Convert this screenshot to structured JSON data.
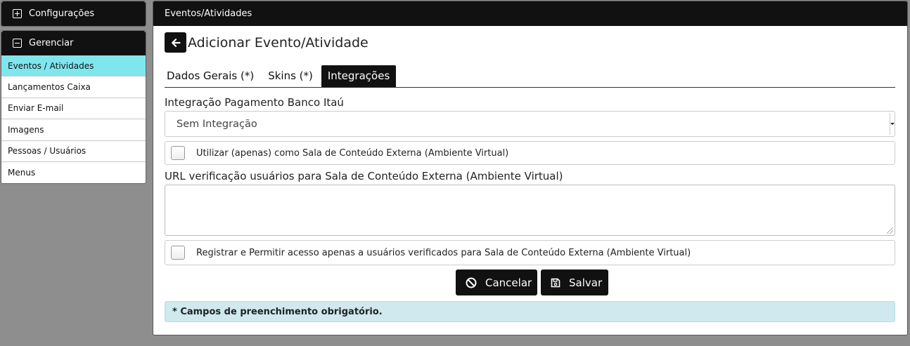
{
  "sidebar": {
    "config_title": "Configurações",
    "manage_title": "Gerenciar",
    "items": [
      {
        "label": "Eventos / Atividades",
        "active": true
      },
      {
        "label": "Lançamentos Caixa"
      },
      {
        "label": "Enviar E-mail"
      },
      {
        "label": "Imagens"
      },
      {
        "label": "Pessoas / Usuários"
      },
      {
        "label": "Menus"
      }
    ]
  },
  "main": {
    "header": "Eventos/Atividades",
    "page_title": "Adicionar Evento/Atividade",
    "tabs": [
      {
        "label": "Dados Gerais (*)"
      },
      {
        "label": "Skins (*)"
      },
      {
        "label": "Integrações",
        "active": true
      }
    ],
    "integration_label": "Integração Pagamento Banco Itaú",
    "integration_value": "Sem Integração",
    "external_room_checkbox": "Utilizar (apenas) como Sala de Conteúdo Externa (Ambiente Virtual)",
    "url_label": "URL verificação usuários para Sala de Conteúdo Externa (Ambiente Virtual)",
    "url_value": "",
    "register_checkbox": "Registrar e Permitir acesso apenas a usuários verificados para Sala de Conteúdo Externa (Ambiente Virtual)",
    "cancel_label": "Cancelar",
    "save_label": "Salvar",
    "required_note": "* Campos de preenchimento obrigatório."
  },
  "colors": {
    "active_menu": "#7fe6ee",
    "header_bg": "#111111",
    "note_bg": "#cfe9ef"
  }
}
